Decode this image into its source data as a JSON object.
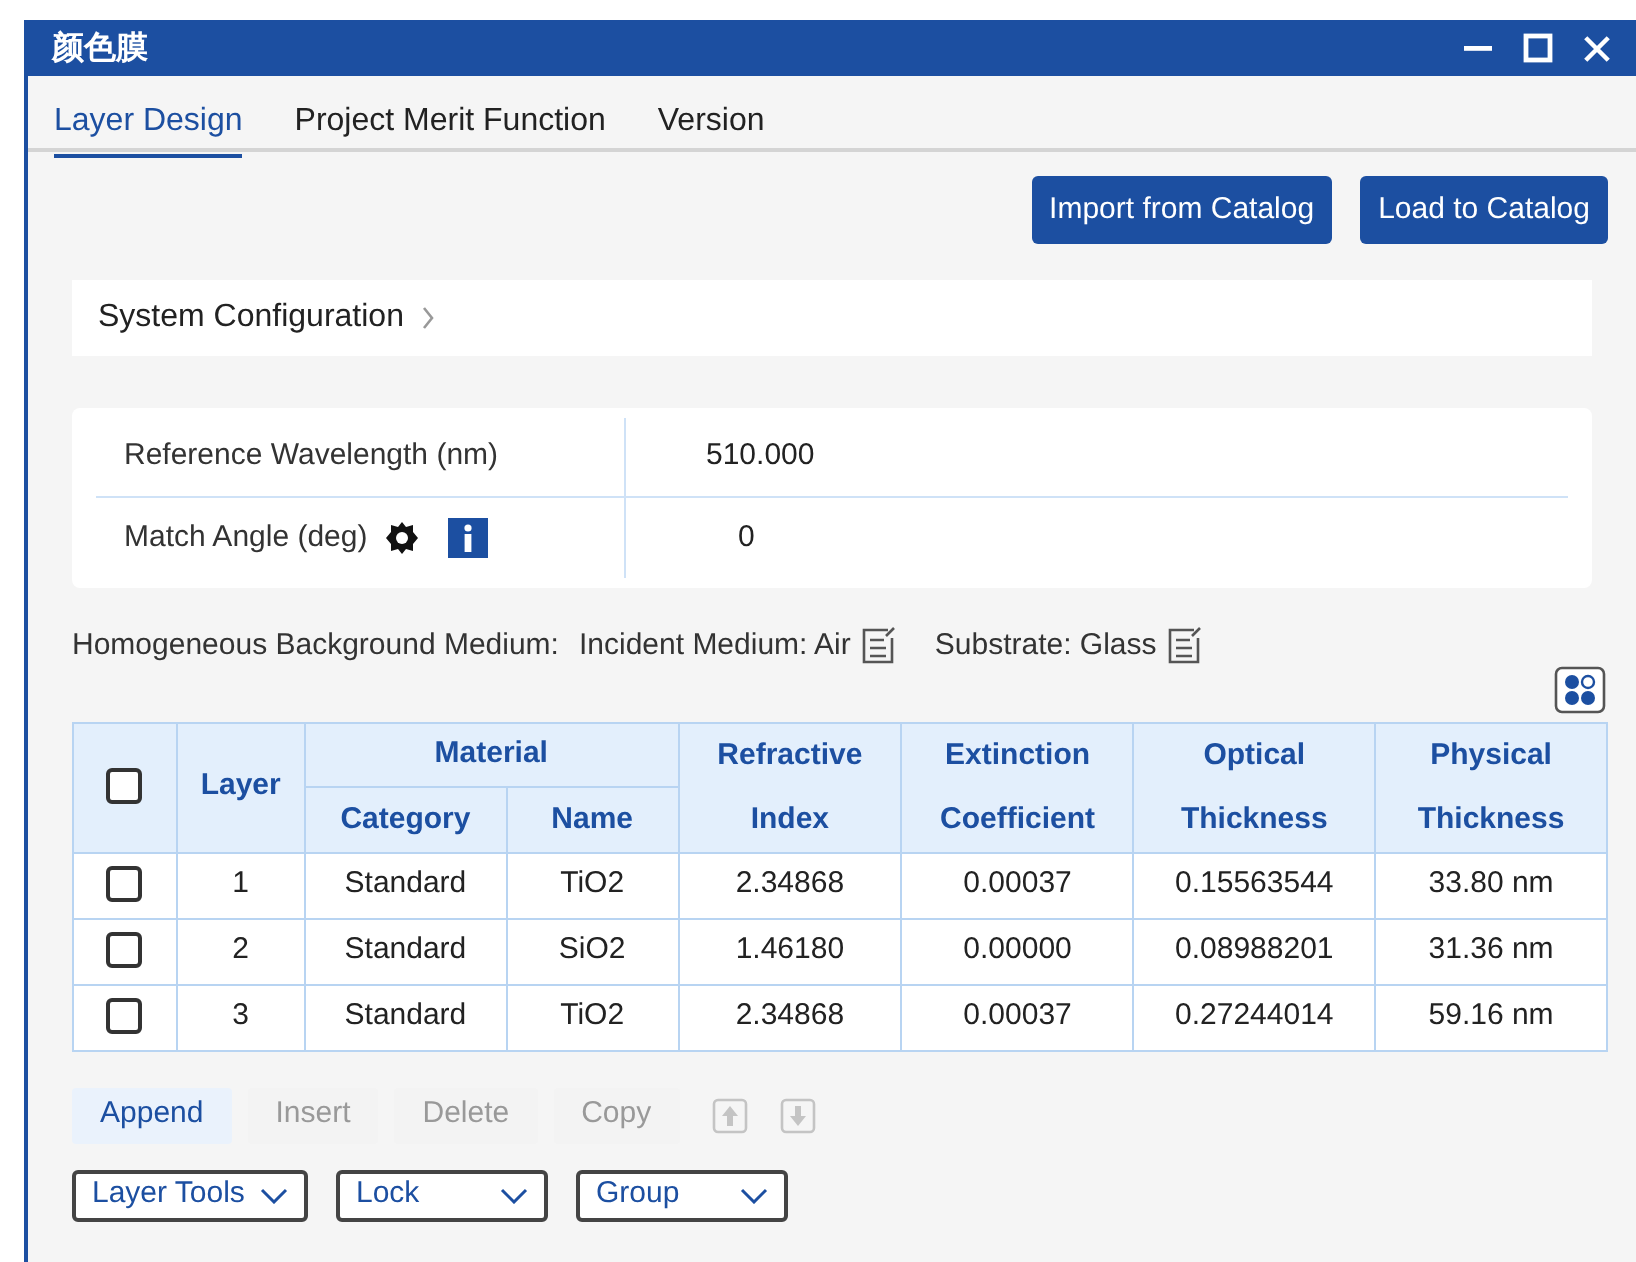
{
  "window": {
    "title": "颜色膜"
  },
  "tabs": [
    {
      "label": "Layer Design",
      "selected": true
    },
    {
      "label": "Project Merit Function",
      "selected": false
    },
    {
      "label": "Version",
      "selected": false
    }
  ],
  "catalog_buttons": [
    "Import from Catalog",
    "Load to Catalog"
  ],
  "system_configuration": {
    "label": "System Configuration",
    "expanded": false
  },
  "settings": [
    {
      "label": "Reference Wavelength (nm)",
      "value": "510.000",
      "kind": "plain"
    },
    {
      "label": "Match Angle (deg)",
      "value": "0",
      "kind": "angle"
    }
  ],
  "background_medium": {
    "label": "Homogeneous Background Medium:",
    "incident": "Incident Medium: Air",
    "substrate": "Substrate: Glass"
  },
  "table": {
    "header_checked": false,
    "group_header": "Material",
    "columns": [
      "Layer",
      "Category",
      "Name",
      "Refractive Index",
      "Extinction Coefficient",
      "Optical Thickness",
      "Physical Thickness"
    ],
    "rows": [
      {
        "checked": false,
        "cells": [
          "1",
          "Standard",
          "TiO2",
          "2.34868",
          "0.00037",
          "0.15563544",
          "33.80 nm"
        ]
      },
      {
        "checked": false,
        "cells": [
          "2",
          "Standard",
          "SiO2",
          "1.46180",
          "0.00000",
          "0.08988201",
          "31.36 nm"
        ]
      },
      {
        "checked": false,
        "cells": [
          "3",
          "Standard",
          "TiO2",
          "2.34868",
          "0.00037",
          "0.27244014",
          "59.16 nm"
        ]
      }
    ]
  },
  "actions": [
    {
      "label": "Append",
      "disabled": false
    },
    {
      "label": "Insert",
      "disabled": true
    },
    {
      "label": "Delete",
      "disabled": true
    },
    {
      "label": "Copy",
      "disabled": true
    }
  ],
  "move_buttons": [
    {
      "kind": "up",
      "disabled": true
    },
    {
      "kind": "down",
      "disabled": true
    }
  ],
  "dropdowns": [
    "Layer Tools",
    "Lock",
    "Group"
  ]
}
